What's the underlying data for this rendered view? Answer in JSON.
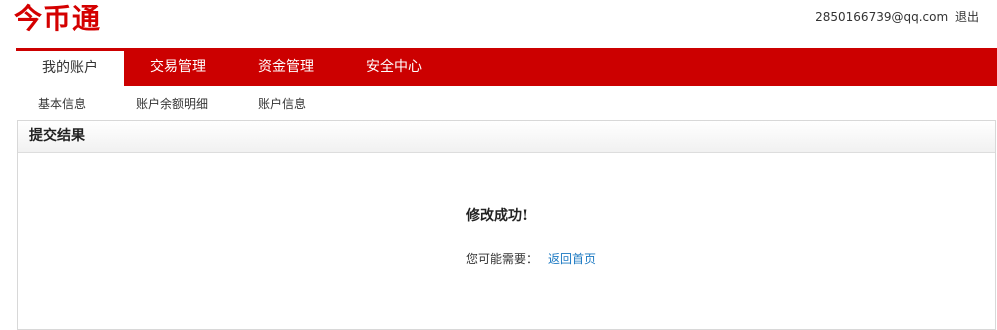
{
  "header": {
    "logo": "今币通",
    "user_email": "2850166739@qq.com",
    "logout_label": "退出"
  },
  "nav": {
    "items": [
      {
        "label": "我的账户",
        "active": true
      },
      {
        "label": "交易管理"
      },
      {
        "label": "资金管理"
      },
      {
        "label": "安全中心"
      }
    ]
  },
  "subnav": {
    "items": [
      {
        "label": "基本信息"
      },
      {
        "label": "账户余额明细"
      },
      {
        "label": "账户信息"
      }
    ]
  },
  "panel": {
    "title": "提交结果",
    "message": "修改成功!",
    "hint_label": "您可能需要：",
    "hint_link": "返回首页"
  },
  "colors": {
    "brand_red": "#cc0000",
    "link_blue": "#1a78c2"
  }
}
